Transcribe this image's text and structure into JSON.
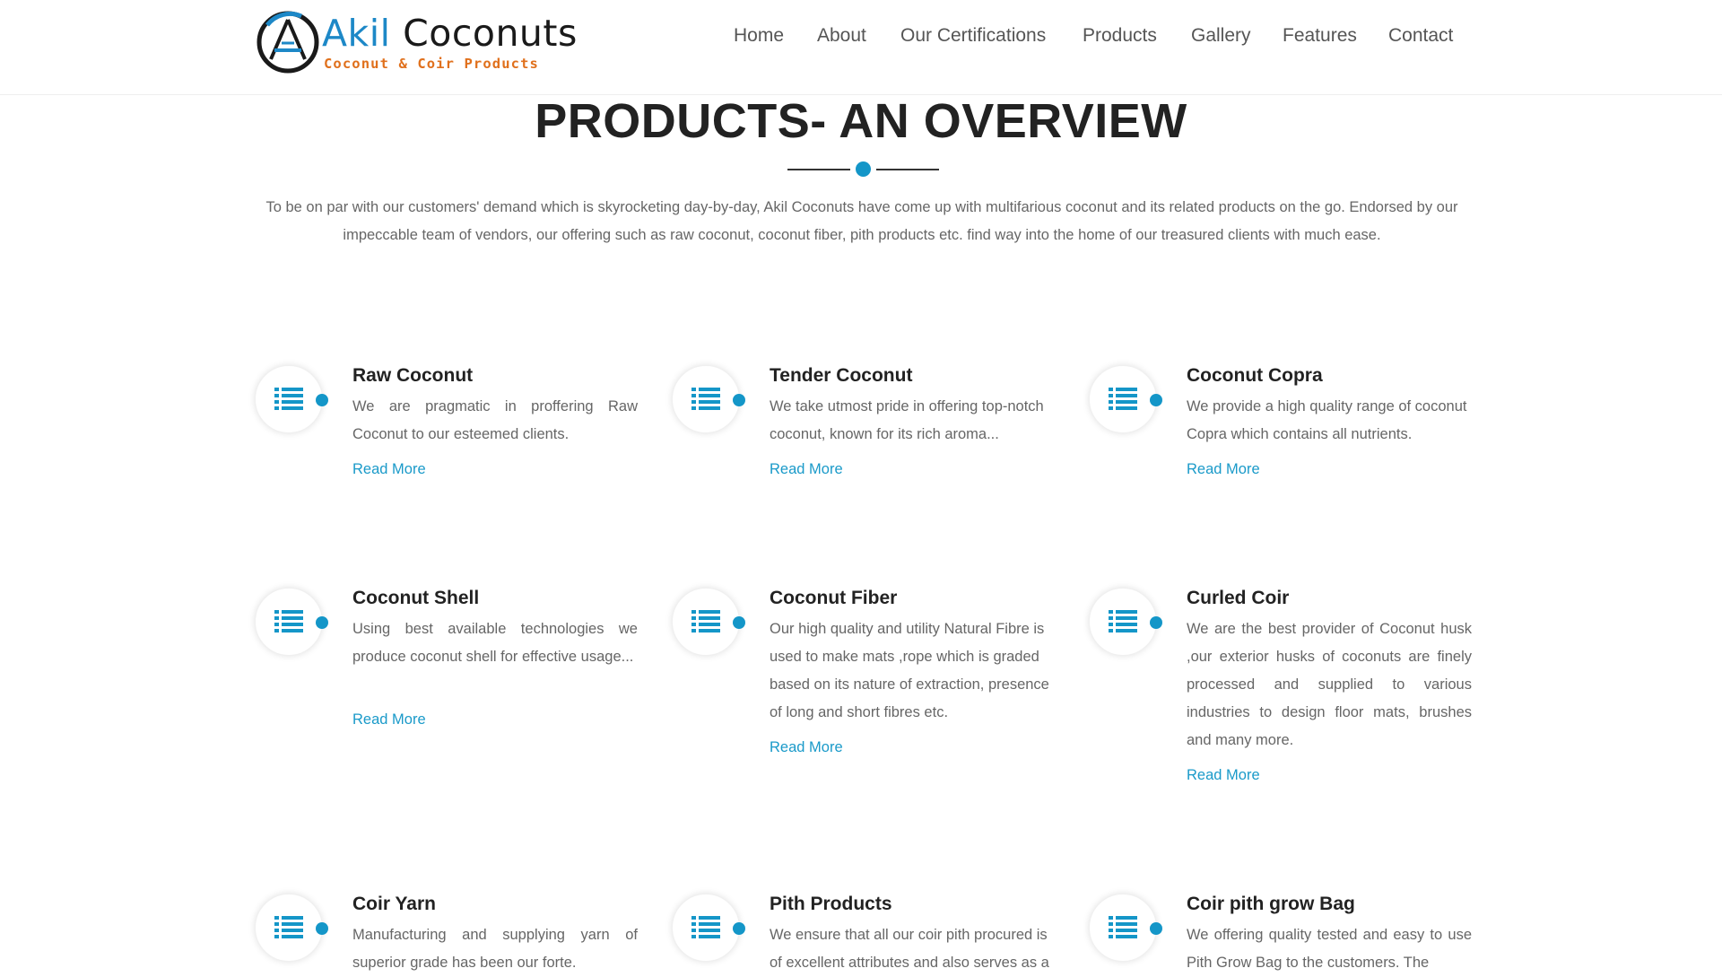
{
  "brand": {
    "name_part1": "Akil",
    "name_part2": " Coconuts",
    "tagline": "Coconut & Coir Products",
    "colors": {
      "blue": "#1d88c7",
      "orange": "#e0701c"
    }
  },
  "nav": {
    "items": [
      {
        "label": "Home"
      },
      {
        "label": "About"
      },
      {
        "label": "Our Certifications"
      },
      {
        "label": "Products"
      },
      {
        "label": "Gallery"
      },
      {
        "label": "Features"
      },
      {
        "label": "Contact"
      }
    ]
  },
  "section": {
    "title": "PRODUCTS- AN OVERVIEW",
    "intro": "To be on par with our customers' demand which is skyrocketing day-by-day, Akil Coconuts have come up with multifarious coconut and its related products on the go. Endorsed by our impeccable team of vendors, our offering such as raw coconut, coconut fiber, pith products etc. find way into the home of our treasured clients with much ease."
  },
  "products": [
    {
      "title": "Raw Coconut",
      "desc": "We are pragmatic in proffering Raw Coconut to our esteemed clients.",
      "link": "Read More",
      "icon": "list-icon"
    },
    {
      "title": "Tender Coconut",
      "desc": "We take utmost pride in offering top-notch coconut, known for its rich aroma...",
      "link": "Read More",
      "icon": "list-icon"
    },
    {
      "title": "Coconut Copra",
      "desc": "We provide a high quality range of coconut Copra which contains all nutrients.",
      "link": "Read More",
      "icon": "list-icon"
    },
    {
      "title": "Coconut Shell",
      "desc": "Using best available technologies we produce coconut shell for effective usage...",
      "link": "Read More",
      "icon": "list-icon"
    },
    {
      "title": "Coconut Fiber",
      "desc": "Our high quality and utility Natural Fibre is used to make mats ,rope which is graded based on its nature of extraction, presence of long and short fibres etc.",
      "link": "Read More",
      "icon": "list-icon"
    },
    {
      "title": "Curled Coir",
      "desc": "We are the best provider of Coconut husk ,our exterior husks of coconuts are finely processed and supplied to various industries to design floor mats, brushes and many more.",
      "link": "Read More",
      "icon": "list-icon"
    },
    {
      "title": "Coir Yarn",
      "desc": "Manufacturing and supplying yarn of superior grade has been our forte.",
      "link": "",
      "icon": "list-icon"
    },
    {
      "title": "Pith Products",
      "desc": "We ensure that all our coir pith procured is of excellent attributes and also serves as a",
      "link": "",
      "icon": "list-icon"
    },
    {
      "title": "Coir pith grow Bag",
      "desc": "We offering quality tested and easy to use Pith Grow Bag to the customers. The",
      "link": "",
      "icon": "list-icon"
    }
  ]
}
